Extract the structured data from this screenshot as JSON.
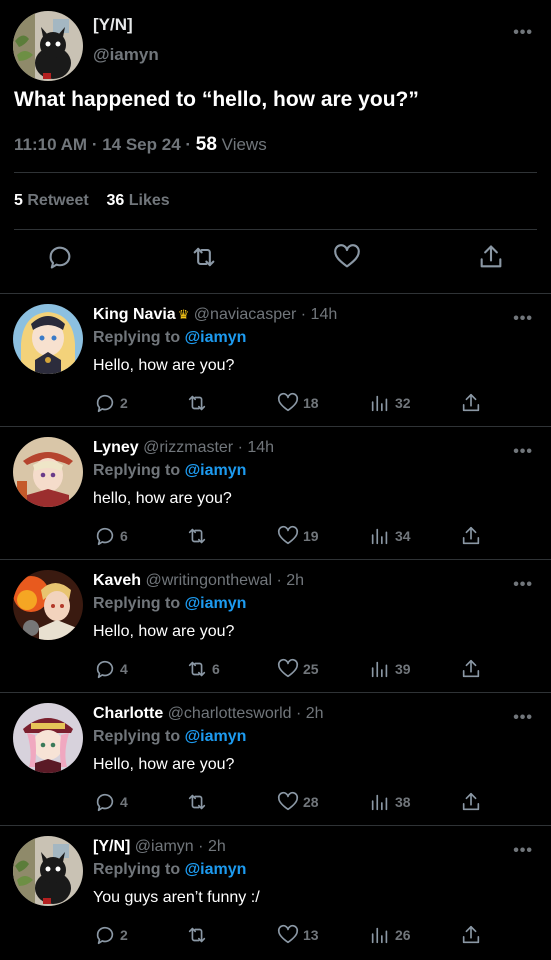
{
  "main": {
    "name": "[Y/N]",
    "handle": "@iamyn",
    "text": "What happened to “hello, how are you?”",
    "time": "11:10 AM",
    "date": "14 Sep 24",
    "views_count": "58",
    "views_word": "Views",
    "retweets_count": "5",
    "retweets_word": "Retweet",
    "likes_count": "36",
    "likes_word": "Likes",
    "more": "•••"
  },
  "replies": [
    {
      "name": "King Navia",
      "has_crown": true,
      "handle": "@naviacasper",
      "time": "14h",
      "replying_prefix": "Replying to",
      "replying_to": "@iamyn",
      "text": "Hello, how are you?",
      "comments": "2",
      "retweets": "",
      "likes": "18",
      "views": "32"
    },
    {
      "name": "Lyney",
      "handle": "@rizzmaster",
      "time": "14h",
      "replying_prefix": "Replying to",
      "replying_to": "@iamyn",
      "text": "hello, how are you?",
      "comments": "6",
      "retweets": "",
      "likes": "19",
      "views": "34"
    },
    {
      "name": "Kaveh",
      "handle": "@writingonthewal",
      "time": "2h",
      "replying_prefix": "Replying to",
      "replying_to": "@iamyn",
      "text": "Hello, how are you?",
      "comments": "4",
      "retweets": "6",
      "likes": "25",
      "views": "39"
    },
    {
      "name": "Charlotte",
      "handle": "@charlottesworld",
      "time": "2h",
      "replying_prefix": "Replying to",
      "replying_to": "@iamyn",
      "text": "Hello, how are you?",
      "comments": "4",
      "retweets": "",
      "likes": "28",
      "views": "38"
    },
    {
      "name": "[Y/N]",
      "handle": "@iamyn",
      "time": "2h",
      "replying_prefix": "Replying to",
      "replying_to": "@iamyn",
      "text": "You guys aren’t funny :/",
      "comments": "2",
      "retweets": "",
      "likes": "13",
      "views": "26"
    }
  ],
  "colors": {
    "background": "#000000",
    "text": "#e7e9ea",
    "muted": "#71767b",
    "link": "#1d9bf0",
    "divider": "#2f3336"
  },
  "icons": [
    "comment-icon",
    "retweet-icon",
    "heart-icon",
    "views-icon",
    "share-icon",
    "more-icon",
    "crown-icon"
  ]
}
